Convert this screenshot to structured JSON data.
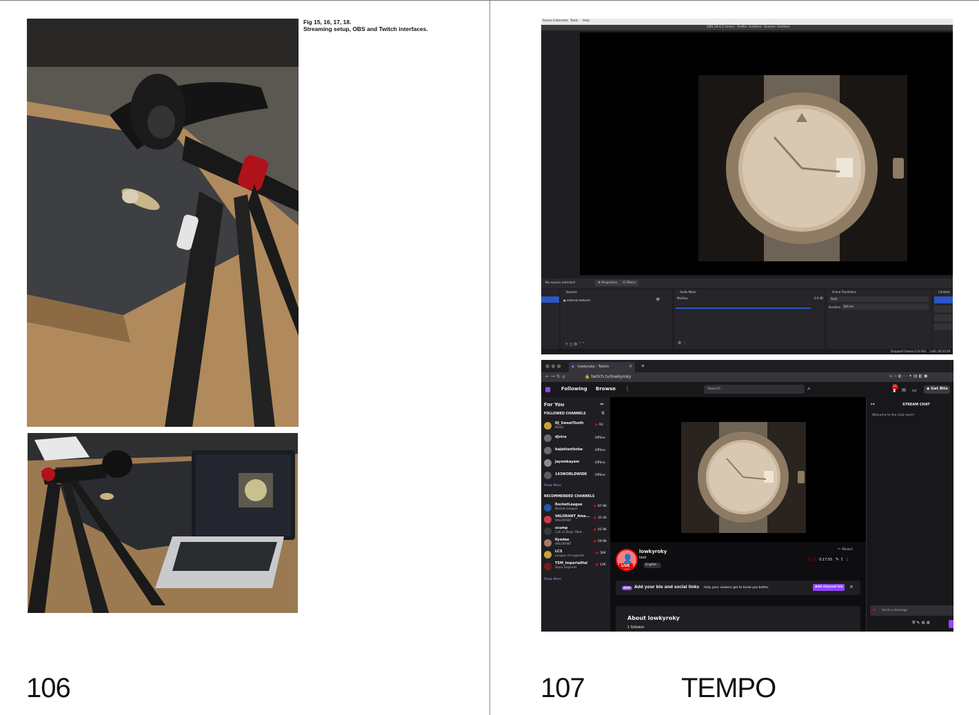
{
  "caption": {
    "line1": "Fig 15, 16, 17, 18.",
    "line2": "Streaming setup, OBS and Twitch interfaces."
  },
  "pages": {
    "left": "106",
    "right": "107",
    "title": "TEMPO"
  },
  "obs": {
    "menu": [
      "Scene Collection",
      "Tools",
      "Help"
    ],
    "title": "OBS 29.0.2 (mac) - Profile: Untitled - Scenes: Untitled",
    "no_source": "No source selected",
    "properties": "Properties",
    "filters": "Filters",
    "panels": {
      "sources": "Sources",
      "audio": "Audio Mixer",
      "transitions": "Scene Transitions",
      "controls": "Controls"
    },
    "source_item": "external webcam",
    "mic": "Mic/Aux",
    "db": "0.0 dB",
    "transition": "Fade",
    "duration_label": "Duration",
    "duration": "300 ms",
    "status": "Dropped Frames 0 (0.0%)",
    "live": "LIVE: 00:10:29"
  },
  "twitch": {
    "tab": "lowkyroky - Twitch",
    "url": "twitch.tv/lowkyroky",
    "nav": {
      "following": "Following",
      "browse": "Browse",
      "search": "Search",
      "get_bits": "Get Bits",
      "notif": "21"
    },
    "sidebar": {
      "for_you": "For You",
      "followed_header": "FOLLOWED CHANNELS",
      "followed": [
        {
          "name": "DJ_SweetTooth",
          "sub": "Music",
          "status": "93",
          "live": true
        },
        {
          "name": "djvice",
          "sub": "",
          "status": "Offline",
          "live": false
        },
        {
          "name": "bajablastboba",
          "sub": "",
          "status": "Offline",
          "live": false
        },
        {
          "name": "jayemkayem",
          "sub": "",
          "status": "Offline",
          "live": false
        },
        {
          "name": "143WORLDWIDE",
          "sub": "",
          "status": "Offline",
          "live": false
        }
      ],
      "show_more": "Show More",
      "recommended_header": "RECOMMENDED CHANNELS",
      "recommended": [
        {
          "name": "RocketLeague",
          "sub": "Rocket League",
          "status": "87.9K"
        },
        {
          "name": "VALORANT_Ame...",
          "sub": "VALORANT",
          "status": "32.2K"
        },
        {
          "name": "scump",
          "sub": "Call of Duty: Mod...",
          "status": "42.9K"
        },
        {
          "name": "Kyedae",
          "sub": "VALORANT",
          "status": "29.9K"
        },
        {
          "name": "LCS",
          "sub": "League of Legends",
          "status": "56K"
        },
        {
          "name": "TSM_ImperialHal",
          "sub": "Apex Legends",
          "status": "12K"
        }
      ],
      "show_more2": "Show More"
    },
    "channel": {
      "name": "lowkyroky",
      "title": "test",
      "tag": "English",
      "live": "LIVE",
      "viewers": "2",
      "uptime": "0:17:55",
      "react": "React"
    },
    "banner": {
      "new": "NEW",
      "text": "Add your bio and social links",
      "sub": "Help your viewers get to know you better",
      "button": "Add channel bio"
    },
    "about": {
      "title": "About lowkyroky",
      "followers": "1 follower"
    },
    "chat": {
      "header": "STREAM CHAT",
      "welcome": "Welcome to the chat room!",
      "placeholder": "Send a message"
    }
  },
  "colors": {
    "twitch_purple": "#9147ff",
    "obs_blue": "#2a57c8",
    "live_red": "#eb0400"
  }
}
